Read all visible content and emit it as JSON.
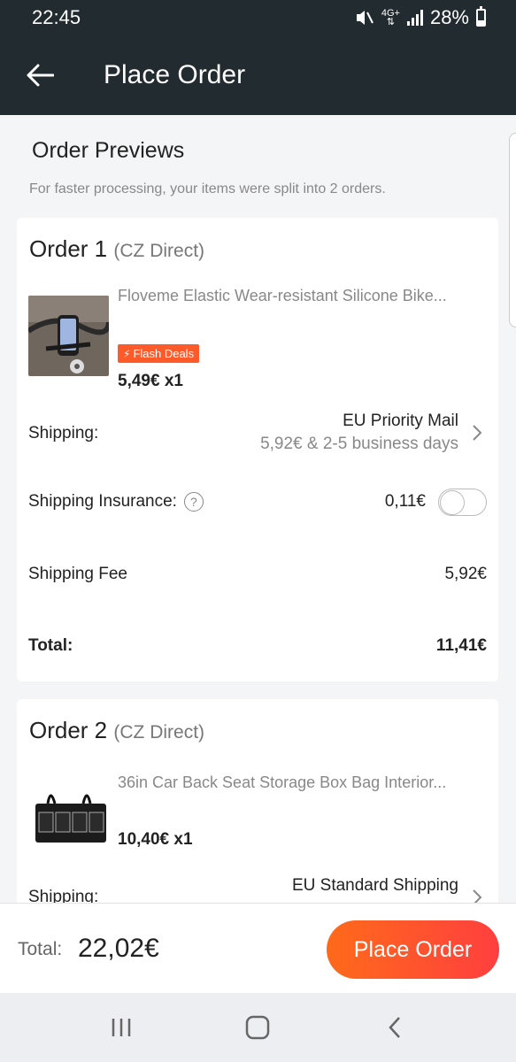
{
  "status_bar": {
    "time": "22:45",
    "network": "4G+",
    "battery": "28%"
  },
  "app_bar": {
    "title": "Place Order"
  },
  "previews": {
    "title": "Order Previews",
    "subtitle": "For faster processing, your items were split into 2 orders."
  },
  "orders": [
    {
      "title": "Order 1",
      "seller": "(CZ Direct)",
      "product_name": "Floveme Elastic Wear-resistant Silicone Bike...",
      "badge": "Flash Deals",
      "price_qty": "5,49€ x1",
      "shipping_label": "Shipping:",
      "shipping_method": "EU Priority Mail",
      "shipping_detail": "5,92€ & 2-5 business days",
      "insurance_label": "Shipping Insurance:",
      "insurance_help": "?",
      "insurance_price": "0,11€",
      "insurance_enabled": false,
      "fee_label": "Shipping Fee",
      "fee_value": "5,92€",
      "total_label": "Total:",
      "total_value": "11,41€"
    },
    {
      "title": "Order 2",
      "seller": "(CZ Direct)",
      "product_name": "36in Car Back Seat Storage Box Bag Interior...",
      "price_qty": "10,40€ x1",
      "shipping_label": "Shipping:",
      "shipping_method": "EU Standard Shipping"
    }
  ],
  "footer": {
    "total_label": "Total:",
    "total_value": "22,02€",
    "button_label": "Place Order"
  },
  "colors": {
    "header_bg": "#222b30",
    "accent": "#ff5a2a",
    "button_gradient_start": "#ff6a1a",
    "button_gradient_end": "#ff3f3f"
  },
  "icons": {
    "back": "arrow-left-icon",
    "help": "question-circle-icon",
    "chevron": "chevron-right-icon",
    "nav_recents": "recents-icon",
    "nav_home": "home-icon",
    "nav_back": "back-icon"
  }
}
